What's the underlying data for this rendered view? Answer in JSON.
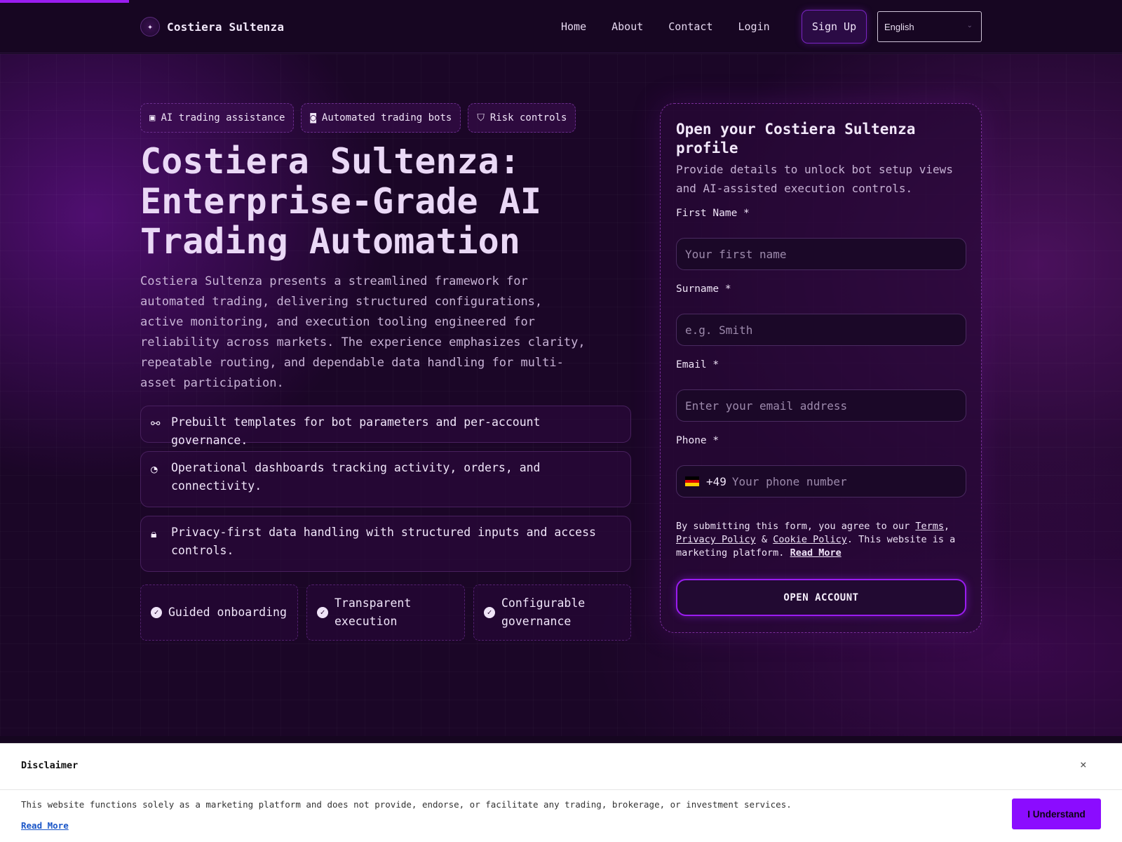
{
  "header": {
    "brand_icon": "sparkle-icon",
    "brand_name": "Costiera Sultenza",
    "nav": [
      "Home",
      "About",
      "Contact",
      "Login"
    ],
    "signup": "Sign Up",
    "language": "English"
  },
  "hero": {
    "badges": [
      {
        "icon": "chip-icon",
        "label": "AI trading assistance"
      },
      {
        "icon": "robot-icon",
        "label": "Automated trading bots"
      },
      {
        "icon": "shield-icon",
        "label": "Risk controls"
      }
    ],
    "title": "Costiera Sultenza: Enterprise-Grade AI Trading Automation",
    "description": "Costiera Sultenza presents a streamlined framework for automated trading, delivering structured configurations, active monitoring, and execution tooling engineered for reliability across markets. The experience emphasizes clarity, repeatable routing, and dependable data handling for multi-asset participation.",
    "features": [
      {
        "icon": "network-icon",
        "text": "Prebuilt templates for bot parameters and per-account governance."
      },
      {
        "icon": "dashboard-icon",
        "text": "Operational dashboards tracking activity, orders, and connectivity."
      },
      {
        "icon": "lock-icon",
        "text": "Privacy-first data handling with structured inputs and access controls."
      }
    ],
    "pills": [
      "Guided onboarding",
      "Transparent execution",
      "Configurable governance"
    ]
  },
  "form": {
    "title": "Open your Costiera Sultenza profile",
    "subtitle": "Provide details to unlock bot setup views and AI-assisted execution controls.",
    "first_name_label": "First Name *",
    "first_name_placeholder": "Your first name",
    "surname_label": "Surname *",
    "surname_placeholder": "e.g. Smith",
    "email_label": "Email *",
    "email_placeholder": "Enter your email address",
    "phone_label": "Phone *",
    "phone_code": "+49",
    "phone_placeholder": "Your phone number",
    "terms_pre": "By submitting this form, you agree to our ",
    "terms_link": "Terms",
    "terms_comma": ",",
    "privacy_link": "Privacy Policy",
    "amp": " & ",
    "cookie_link": "Cookie Policy",
    "terms_post": ". This website is a marketing platform. ",
    "read_more": "Read More",
    "submit": "OPEN ACCOUNT"
  },
  "disclaimer": {
    "title": "Disclaimer",
    "close": "×",
    "text": "This website functions solely as a marketing platform and does not provide, endorse, or facilitate any trading, brokerage, or investment services.",
    "read_more": "Read More",
    "button": "I Understand"
  },
  "colors": {
    "accent": "#9a1cf0",
    "background": "#1b0627",
    "disclaimer_button": "#8b0cff"
  }
}
